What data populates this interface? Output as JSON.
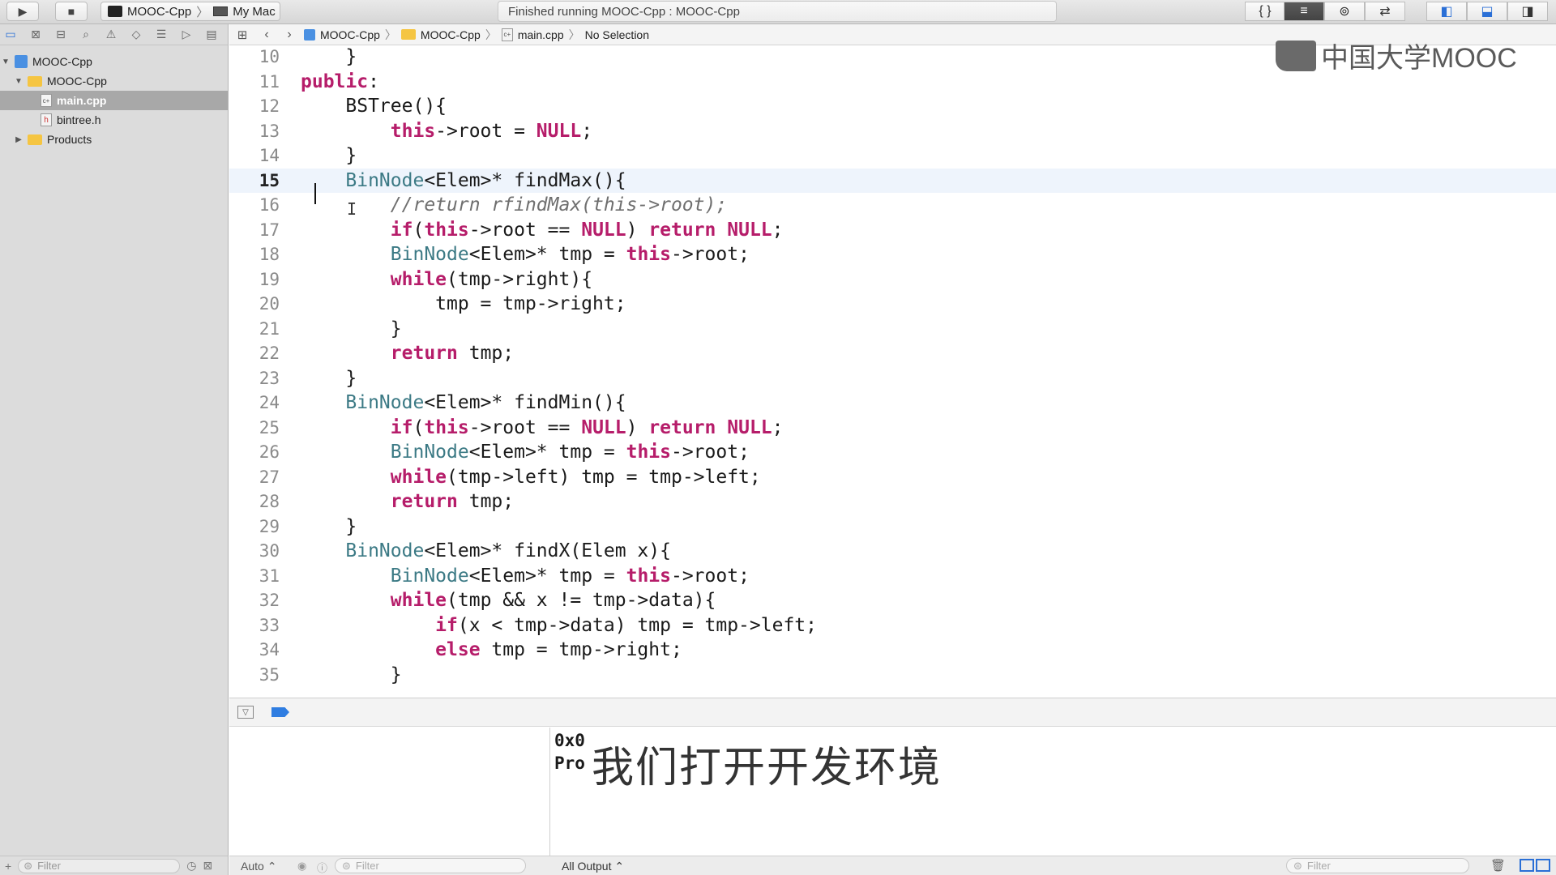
{
  "toolbar": {
    "scheme_name": "MOOC-Cpp",
    "destination": "My Mac",
    "activity_status": "Finished running MOOC-Cpp : MOOC-Cpp",
    "run_icon": "play-icon",
    "stop_icon": "stop-icon"
  },
  "navigator": {
    "tabs": [
      "project-navigator",
      "source-control",
      "symbol-navigator",
      "find",
      "issues",
      "tests",
      "debug",
      "breakpoints",
      "reports"
    ],
    "items": [
      {
        "label": "MOOC-Cpp",
        "kind": "project",
        "level": 0,
        "expanded": true
      },
      {
        "label": "MOOC-Cpp",
        "kind": "folder",
        "level": 1,
        "expanded": true
      },
      {
        "label": "main.cpp",
        "kind": "cpp",
        "level": 2,
        "selected": true
      },
      {
        "label": "bintree.h",
        "kind": "header",
        "level": 2
      },
      {
        "label": "Products",
        "kind": "folder",
        "level": 1,
        "expanded": false
      }
    ],
    "filter_placeholder": "Filter"
  },
  "jumpbar": {
    "crumbs": [
      "MOOC-Cpp",
      "MOOC-Cpp",
      "main.cpp",
      "No Selection"
    ]
  },
  "watermark": "中国大学MOOC",
  "editor": {
    "current_line": 15,
    "lines": [
      {
        "n": "10",
        "tokens": [
          {
            "t": "    }"
          }
        ]
      },
      {
        "n": "11",
        "tokens": [
          {
            "t": "public",
            "c": "kw"
          },
          {
            "t": ":"
          }
        ]
      },
      {
        "n": "12",
        "tokens": [
          {
            "t": "    BSTree(){"
          }
        ]
      },
      {
        "n": "13",
        "tokens": [
          {
            "t": "        "
          },
          {
            "t": "this",
            "c": "kw"
          },
          {
            "t": "->root = "
          },
          {
            "t": "NULL",
            "c": "kw"
          },
          {
            "t": ";"
          }
        ]
      },
      {
        "n": "14",
        "tokens": [
          {
            "t": "    }"
          }
        ]
      },
      {
        "n": "15",
        "tokens": [
          {
            "t": "    "
          },
          {
            "t": "BinNode",
            "c": "ty"
          },
          {
            "t": "<Elem>* findMax(){"
          }
        ]
      },
      {
        "n": "16",
        "tokens": [
          {
            "t": "        "
          },
          {
            "t": "//return rfindMax(this->root);",
            "c": "cm"
          }
        ]
      },
      {
        "n": "17",
        "tokens": [
          {
            "t": "        "
          },
          {
            "t": "if",
            "c": "kw"
          },
          {
            "t": "("
          },
          {
            "t": "this",
            "c": "kw"
          },
          {
            "t": "->root == "
          },
          {
            "t": "NULL",
            "c": "kw"
          },
          {
            "t": ") "
          },
          {
            "t": "return",
            "c": "kw"
          },
          {
            "t": " "
          },
          {
            "t": "NULL",
            "c": "kw"
          },
          {
            "t": ";"
          }
        ]
      },
      {
        "n": "18",
        "tokens": [
          {
            "t": "        "
          },
          {
            "t": "BinNode",
            "c": "ty"
          },
          {
            "t": "<Elem>* tmp = "
          },
          {
            "t": "this",
            "c": "kw"
          },
          {
            "t": "->root;"
          }
        ]
      },
      {
        "n": "19",
        "tokens": [
          {
            "t": "        "
          },
          {
            "t": "while",
            "c": "kw"
          },
          {
            "t": "(tmp->right){"
          }
        ]
      },
      {
        "n": "20",
        "tokens": [
          {
            "t": "            tmp = tmp->right;"
          }
        ]
      },
      {
        "n": "21",
        "tokens": [
          {
            "t": "        }"
          }
        ]
      },
      {
        "n": "22",
        "tokens": [
          {
            "t": "        "
          },
          {
            "t": "return",
            "c": "kw"
          },
          {
            "t": " tmp;"
          }
        ]
      },
      {
        "n": "23",
        "tokens": [
          {
            "t": "    }"
          }
        ]
      },
      {
        "n": "24",
        "tokens": [
          {
            "t": "    "
          },
          {
            "t": "BinNode",
            "c": "ty"
          },
          {
            "t": "<Elem>* findMin(){"
          }
        ]
      },
      {
        "n": "25",
        "tokens": [
          {
            "t": "        "
          },
          {
            "t": "if",
            "c": "kw"
          },
          {
            "t": "("
          },
          {
            "t": "this",
            "c": "kw"
          },
          {
            "t": "->root == "
          },
          {
            "t": "NULL",
            "c": "kw"
          },
          {
            "t": ") "
          },
          {
            "t": "return",
            "c": "kw"
          },
          {
            "t": " "
          },
          {
            "t": "NULL",
            "c": "kw"
          },
          {
            "t": ";"
          }
        ]
      },
      {
        "n": "26",
        "tokens": [
          {
            "t": "        "
          },
          {
            "t": "BinNode",
            "c": "ty"
          },
          {
            "t": "<Elem>* tmp = "
          },
          {
            "t": "this",
            "c": "kw"
          },
          {
            "t": "->root;"
          }
        ]
      },
      {
        "n": "27",
        "tokens": [
          {
            "t": "        "
          },
          {
            "t": "while",
            "c": "kw"
          },
          {
            "t": "(tmp->left) tmp = tmp->left;"
          }
        ]
      },
      {
        "n": "28",
        "tokens": [
          {
            "t": "        "
          },
          {
            "t": "return",
            "c": "kw"
          },
          {
            "t": " tmp;"
          }
        ]
      },
      {
        "n": "29",
        "tokens": [
          {
            "t": "    }"
          }
        ]
      },
      {
        "n": "30",
        "tokens": [
          {
            "t": "    "
          },
          {
            "t": "BinNode",
            "c": "ty"
          },
          {
            "t": "<Elem>* findX(Elem x){"
          }
        ]
      },
      {
        "n": "31",
        "tokens": [
          {
            "t": "        "
          },
          {
            "t": "BinNode",
            "c": "ty"
          },
          {
            "t": "<Elem>* tmp = "
          },
          {
            "t": "this",
            "c": "kw"
          },
          {
            "t": "->root;"
          }
        ]
      },
      {
        "n": "32",
        "tokens": [
          {
            "t": "        "
          },
          {
            "t": "while",
            "c": "kw"
          },
          {
            "t": "(tmp && x != tmp->data){"
          }
        ]
      },
      {
        "n": "33",
        "tokens": [
          {
            "t": "            "
          },
          {
            "t": "if",
            "c": "kw"
          },
          {
            "t": "(x < tmp->data) tmp = tmp->left;"
          }
        ]
      },
      {
        "n": "34",
        "tokens": [
          {
            "t": "            "
          },
          {
            "t": "else",
            "c": "kw"
          },
          {
            "t": " tmp = tmp->right;"
          }
        ]
      },
      {
        "n": "35",
        "tokens": [
          {
            "t": "        }"
          }
        ]
      }
    ]
  },
  "debug": {
    "console_lines": [
      "0x0",
      "Pro"
    ],
    "subtitle": "我们打开开发环境",
    "variables_scope": "Auto",
    "output_selector": "All Output",
    "filter_placeholder": "Filter"
  }
}
